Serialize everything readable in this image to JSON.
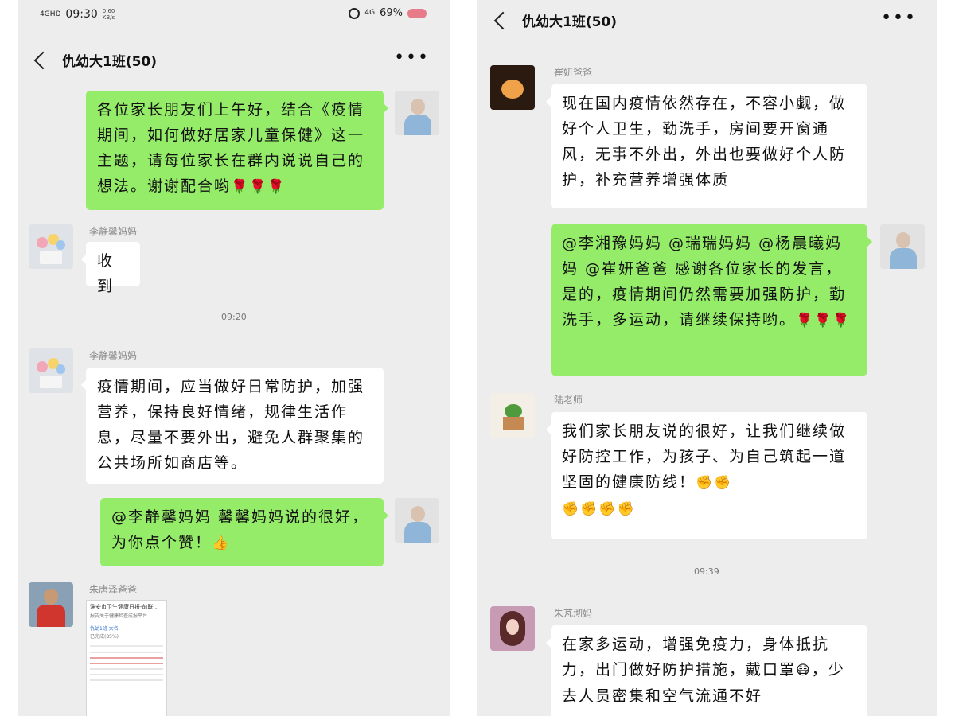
{
  "left": {
    "status": {
      "signal": "4GHD",
      "time": "09:30",
      "speed": "0.60\nKB/s",
      "network": "4G",
      "battery": "69%"
    },
    "title": "仇幼大1班(50)",
    "more": "•••",
    "msg1": {
      "text": "各位家长朋友们上午好，结合《疫情期间，如何做好居家儿童保健》这一主题，请每位家长在群内说说自己的想法。谢谢配合哟",
      "emoji": "🌹🌹🌹"
    },
    "msg2": {
      "sender": "李静馨妈妈",
      "text": "收到"
    },
    "time1": "09:20",
    "msg3": {
      "sender": "李静馨妈妈",
      "text": "疫情期间，应当做好日常防护，加强营养，保持良好情绪，规律生活作息，尽量不要外出，避免人群聚集的公共场所如商店等。"
    },
    "msg4": {
      "text": "@李静馨妈妈  馨馨妈妈说的很好，为你点个赞！",
      "emoji": "👍"
    },
    "msg5": {
      "sender": "朱唐泽爸爸",
      "image": {
        "title": "淮安市卫生健康日报-前联…",
        "sub": "报告关于健康检查成报平台",
        "name": "仇幼1班 大名",
        "sub2": "已完成(85%)"
      }
    }
  },
  "right": {
    "title": "仇幼大1班(50)",
    "more": "•••",
    "msg1": {
      "sender": "崔妍爸爸",
      "text": "现在国内疫情依然存在，不容小觑，做好个人卫生，勤洗手，房间要开窗通风，无事不外出，外出也要做好个人防护，补充营养增强体质"
    },
    "msg2": {
      "text": "@李湘豫妈妈 @瑞瑞妈妈 @杨晨曦妈妈 @崔妍爸爸 感谢各位家长的发言，是的，疫情期间仍然需要加强防护，勤洗手，多运动，请继续保持哟。",
      "emoji": "🌹🌹🌹"
    },
    "msg3": {
      "sender": "陆老师",
      "text": "我们家长朋友说的很好，让我们继续做好防控工作，为孩子、为自己筑起一道坚固的健康防线！",
      "emoji1": "✊✊",
      "emoji2": "✊✊✊✊"
    },
    "time1": "09:39",
    "msg4": {
      "sender": "朱芃沏妈",
      "text": "在家多运动，增强免疫力，身体抵抗力，出门做好防护措施，戴口罩",
      "emoji": "😷",
      "text2": "，少去人员密集和空气流通不好"
    }
  }
}
